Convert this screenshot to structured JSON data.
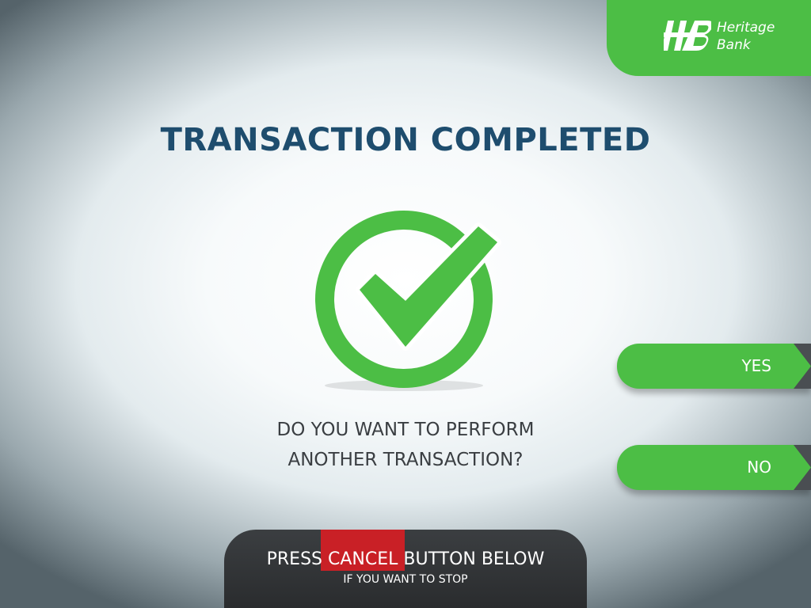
{
  "brand": {
    "name_line1": "Heritage",
    "name_line2": "Bank",
    "logo_icon": "hb-monogram-icon",
    "color": "#4cbe45"
  },
  "screen": {
    "title": "TRANSACTION COMPLETED",
    "status_icon": "check-circle-icon",
    "question_line1": "DO YOU WANT TO PERFORM",
    "question_line2": "ANOTHER TRANSACTION?"
  },
  "options": {
    "yes_label": "YES",
    "no_label": "NO"
  },
  "cancel_hint": {
    "prefix": "PRESS",
    "highlight": "CANCEL",
    "suffix": "BUTTON BELOW",
    "subtext": "IF YOU WANT TO STOP",
    "highlight_color": "#c92026"
  },
  "colors": {
    "title": "#1e4d6e",
    "accent_green": "#4cbe45",
    "panel_dark": "#2f3235"
  }
}
